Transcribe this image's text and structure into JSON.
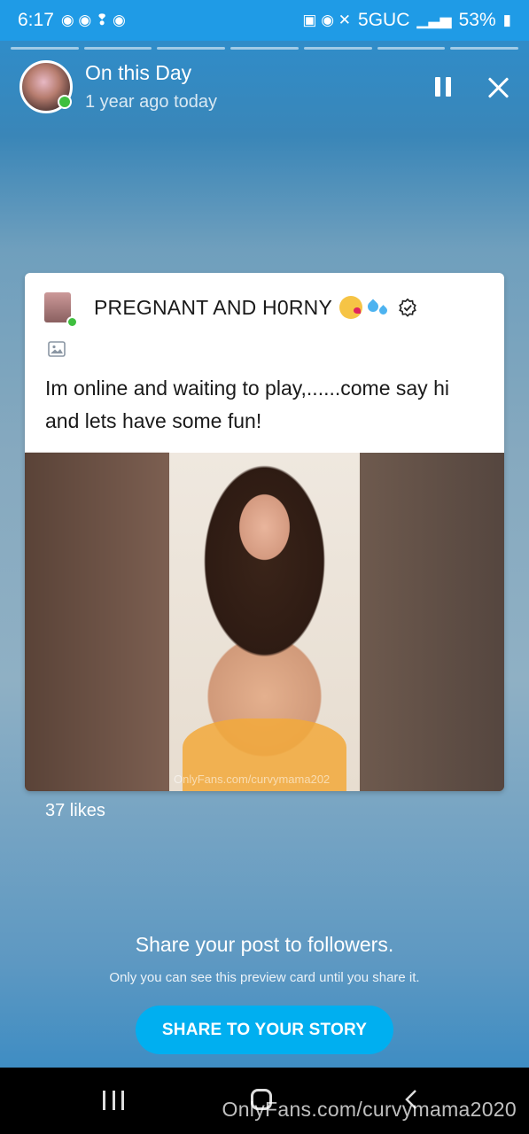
{
  "status_bar": {
    "time": "6:17",
    "network": "5GUC",
    "battery": "53%"
  },
  "story": {
    "segments": 7,
    "title": "On this Day",
    "subtitle": "1 year ago today"
  },
  "post": {
    "author": "PREGNANT AND H0RNY",
    "text": "Im online and waiting to play,......come say hi and lets have some fun!",
    "media_watermark": "OnlyFans.com/curvymama202",
    "likes": "37 likes"
  },
  "share": {
    "title": "Share your post to followers.",
    "subtitle": "Only you can see this preview card until you share it.",
    "button_label": "SHARE TO YOUR STORY"
  },
  "nav": {
    "watermark": "OnlyFans.com/curvymama2020"
  },
  "colors": {
    "accent": "#00aff0",
    "status_bar": "#1f9be6",
    "online": "#3fbf3f"
  }
}
